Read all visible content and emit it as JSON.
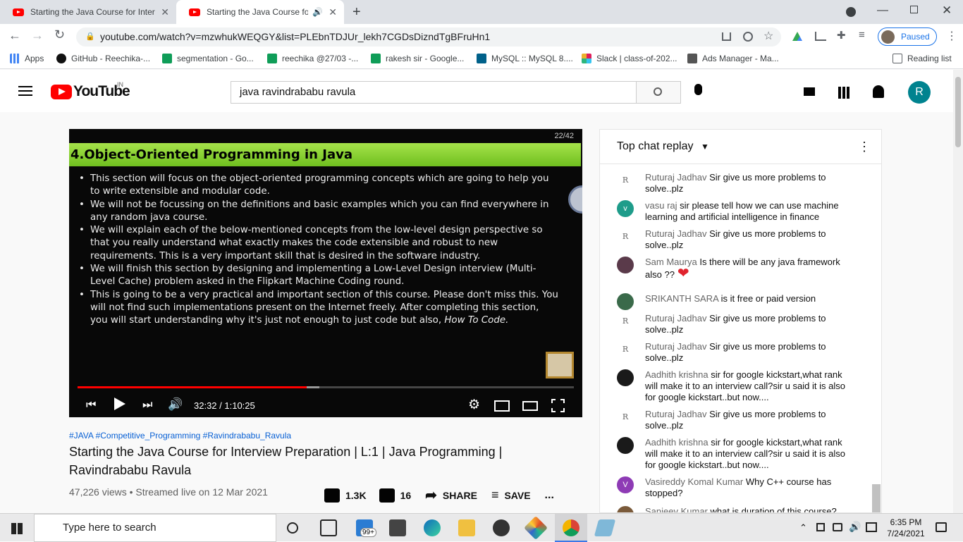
{
  "browser": {
    "tabs": [
      {
        "title": "Starting the Java Course for Inter",
        "close": "✕"
      },
      {
        "title": "Starting the Java Course for I",
        "close": "✕"
      }
    ],
    "new_tab": "+",
    "url": "youtube.com/watch?v=mzwhukWEQGY&list=PLEbnTDJUr_lekh7CGDsDizndTgBFruHn1",
    "profile_status": "Paused",
    "bookmarks": [
      "Apps",
      "GitHub - Reechika-...",
      "segmentation - Go...",
      "reechika @27/03 -...",
      "rakesh sir - Google...",
      "MySQL :: MySQL 8....",
      "Slack | class-of-202...",
      "Ads Manager - Ma..."
    ],
    "reading_list": "Reading list"
  },
  "youtube": {
    "logo_text": "YouTube",
    "country": "IN",
    "search_value": "java ravindrababu ravula",
    "avatar_letter": "R"
  },
  "player": {
    "slide_counter": "22/42",
    "slide_title": "4.Object-Oriented Programming in Java",
    "bullets": [
      "This section will focus on the object-oriented programming concepts which are going to help you to write extensible and modular code.",
      "We will not be focussing on the definitions and basic examples which you can find everywhere in any random java course.",
      "We will explain each of the below-mentioned concepts from the low-level design perspective so that you really understand what exactly makes the code extensible and robust to new requirements. This is a very important skill that is desired in the software industry.",
      "We will finish this section by designing and implementing a Low-Level Design interview (Multi-Level Cache) problem asked in the Flipkart Machine Coding round.",
      "This is going to be a very practical and important section of this course. Please don't miss this. You will not find such implementations present on the Internet freely. After completing this section, you will start understanding why it's just not enough to just code but also,"
    ],
    "bullet_tail": "How To Code.",
    "time": "32:32 / 1:10:25",
    "progress_fraction": 0.462,
    "buffered_fraction": 0.487
  },
  "video": {
    "hashtags": "#JAVA #Competitive_Programming #Ravindrababu_Ravula",
    "title": "Starting the Java Course for Interview Preparation | L:1 | Java Programming | Ravindrababu Ravula",
    "meta": "47,226 views • Streamed live on 12 Mar 2021",
    "likes": "1.3K",
    "dislikes": "16",
    "share": "SHARE",
    "save": "SAVE",
    "more": "..."
  },
  "chat": {
    "header": "Top chat replay",
    "messages": [
      {
        "avatar": "R",
        "color": "#ffffff",
        "author": "Ruturaj Jadhav",
        "text": "Sir give us more problems to solve..plz"
      },
      {
        "avatar": "v",
        "color": "#1e9c8a",
        "author": "vasu raj",
        "text": "sir please tell how we can use machine learning and artificial intelligence in finance"
      },
      {
        "avatar": "R",
        "color": "#ffffff",
        "author": "Ruturaj Jadhav",
        "text": "Sir give us more problems to solve..plz"
      },
      {
        "avatar": "",
        "color": "#5a3a4a",
        "author": "Sam Maurya",
        "text": "Is there will be any java framework also ??"
      },
      {
        "avatar": "",
        "color": "#3a6a4a",
        "author": "SRIKANTH SARA",
        "text": "is it free or paid version"
      },
      {
        "avatar": "R",
        "color": "#ffffff",
        "author": "Ruturaj Jadhav",
        "text": "Sir give us more problems to solve..plz"
      },
      {
        "avatar": "R",
        "color": "#ffffff",
        "author": "Ruturaj Jadhav",
        "text": "Sir give us more problems to solve..plz"
      },
      {
        "avatar": "",
        "color": "#1a1a1a",
        "author": "Aadhith krishna",
        "text": "sir for google kickstart,what rank will make it to an interview call?sir u said it is also for google kickstart..but now...."
      },
      {
        "avatar": "R",
        "color": "#ffffff",
        "author": "Ruturaj Jadhav",
        "text": "Sir give us more problems to solve..plz"
      },
      {
        "avatar": "",
        "color": "#1a1a1a",
        "author": "Aadhith krishna",
        "text": "sir for google kickstart,what rank will make it to an interview call?sir u said it is also for google kickstart..but now...."
      },
      {
        "avatar": "V",
        "color": "#8e3bb5",
        "author": "Vasireddy Komal Kumar",
        "text": "Why C++ course has stopped?"
      },
      {
        "avatar": "",
        "color": "#7a5a3a",
        "author": "Sanjeev Kumar",
        "text": "what is duration of this course?"
      }
    ]
  },
  "taskbar": {
    "search_placeholder": "Type here to search",
    "mail_badge": "99+",
    "time": "6:35 PM",
    "date": "7/24/2021"
  }
}
